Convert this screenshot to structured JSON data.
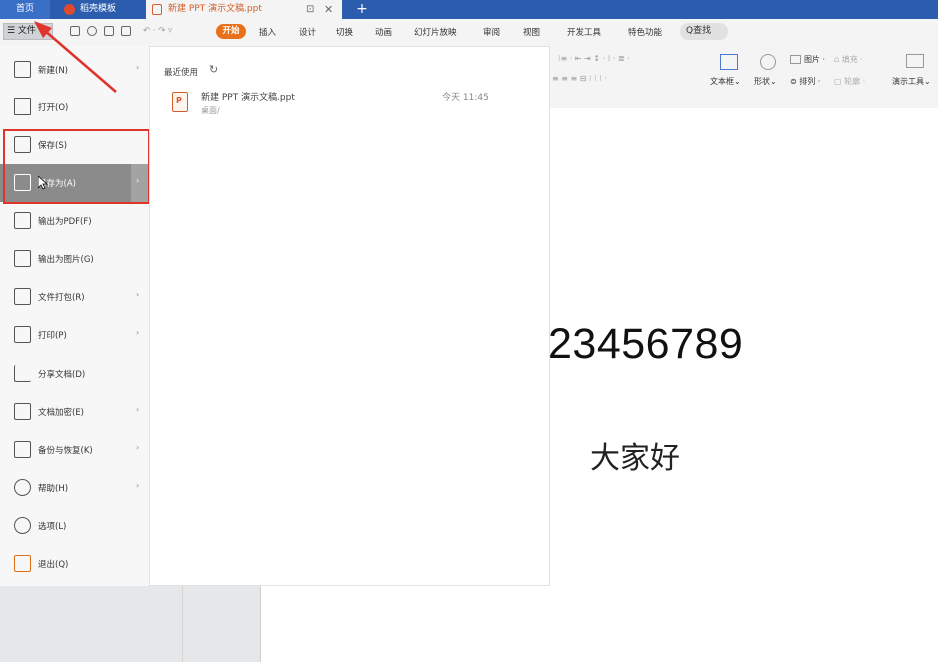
{
  "tabs": {
    "home": "首页",
    "daoke": "稻壳模板",
    "ppt": "新建 PPT 演示文稿.ppt",
    "plus": "+"
  },
  "ribbon": {
    "file": "☰ 文件",
    "start": "开始",
    "menu": [
      "插入",
      "设计",
      "切换",
      "动画",
      "幻灯片放映",
      "审阅",
      "视图",
      "开发工具",
      "特色功能"
    ],
    "search": "Q查找"
  },
  "toolbar": {
    "textbox": "文本框",
    "shape": "形状",
    "picture": "图片",
    "arrange": "排列",
    "fill": "填充",
    "outline": "轮廓",
    "present_tools": "演示工具"
  },
  "file_menu": {
    "items": [
      {
        "label": "新建(N)",
        "arrow": "›"
      },
      {
        "label": "打开(O)",
        "arrow": ""
      },
      {
        "label": "保存(S)",
        "arrow": ""
      },
      {
        "label": "另存为(A)",
        "arrow": "›"
      },
      {
        "label": "输出为PDF(F)",
        "arrow": ""
      },
      {
        "label": "输出为图片(G)",
        "arrow": ""
      },
      {
        "label": "文件打包(R)",
        "arrow": "›"
      },
      {
        "label": "打印(P)",
        "arrow": "›"
      },
      {
        "label": "分享文档(D)",
        "arrow": ""
      },
      {
        "label": "文档加密(E)",
        "arrow": "›"
      },
      {
        "label": "备份与恢复(K)",
        "arrow": "›"
      },
      {
        "label": "帮助(H)",
        "arrow": "›"
      },
      {
        "label": "选项(L)",
        "arrow": ""
      },
      {
        "label": "退出(Q)",
        "arrow": ""
      }
    ]
  },
  "recent": {
    "title": "最近使用",
    "file_name": "新建 PPT 演示文稿.ppt",
    "file_path": "桌面/",
    "file_time": "今天 11:45"
  },
  "slide": {
    "number": "23456789",
    "text": "大家好"
  },
  "colors": {
    "tabbar": "#2b5cad",
    "accent": "#e8701a",
    "highlight": "#e0332c"
  }
}
